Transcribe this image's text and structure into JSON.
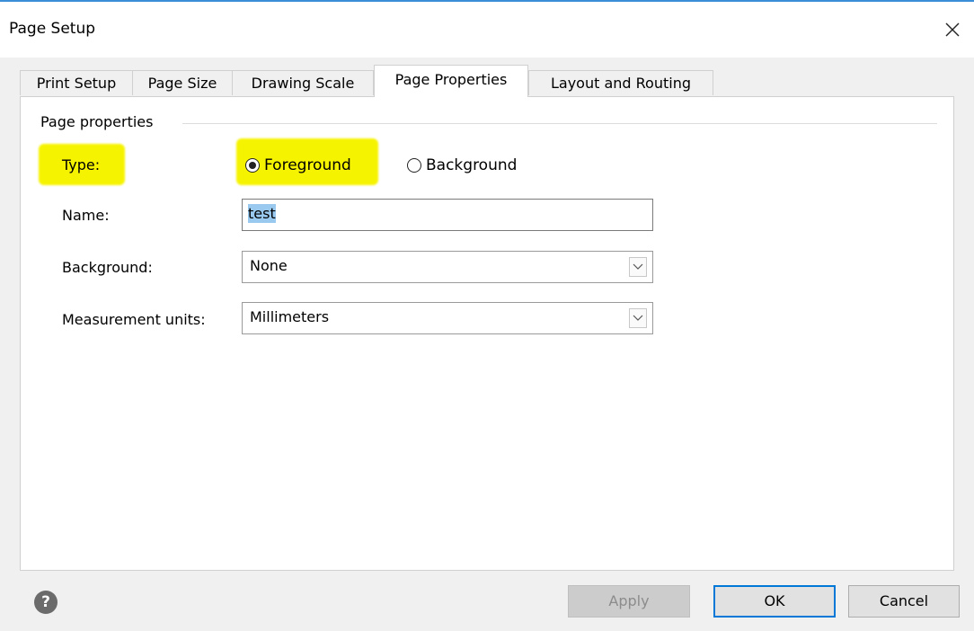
{
  "window": {
    "title": "Page Setup"
  },
  "tabs": [
    {
      "label": "Print Setup",
      "active": false
    },
    {
      "label": "Page Size",
      "active": false
    },
    {
      "label": "Drawing Scale",
      "active": false
    },
    {
      "label": "Page Properties",
      "active": true
    },
    {
      "label": "Layout and Routing",
      "active": false
    }
  ],
  "page_properties": {
    "group_label": "Page properties",
    "type_label": "Type:",
    "type_options": [
      {
        "label": "Foreground",
        "selected": true
      },
      {
        "label": "Background",
        "selected": false
      }
    ],
    "name_label": "Name:",
    "name_value": "test",
    "background_label": "Background:",
    "background_value": "None",
    "units_label": "Measurement units:",
    "units_value": "Millimeters"
  },
  "footer": {
    "apply_label": "Apply",
    "ok_label": "OK",
    "cancel_label": "Cancel"
  },
  "icons": {
    "close": "close-icon",
    "help": "help-icon",
    "dropdown": "chevron-down-icon"
  },
  "colors": {
    "highlight": "#f6f300",
    "selection": "#99c9ef",
    "default_button_border": "#0078d7",
    "title_accent": "#3c8dd8"
  }
}
